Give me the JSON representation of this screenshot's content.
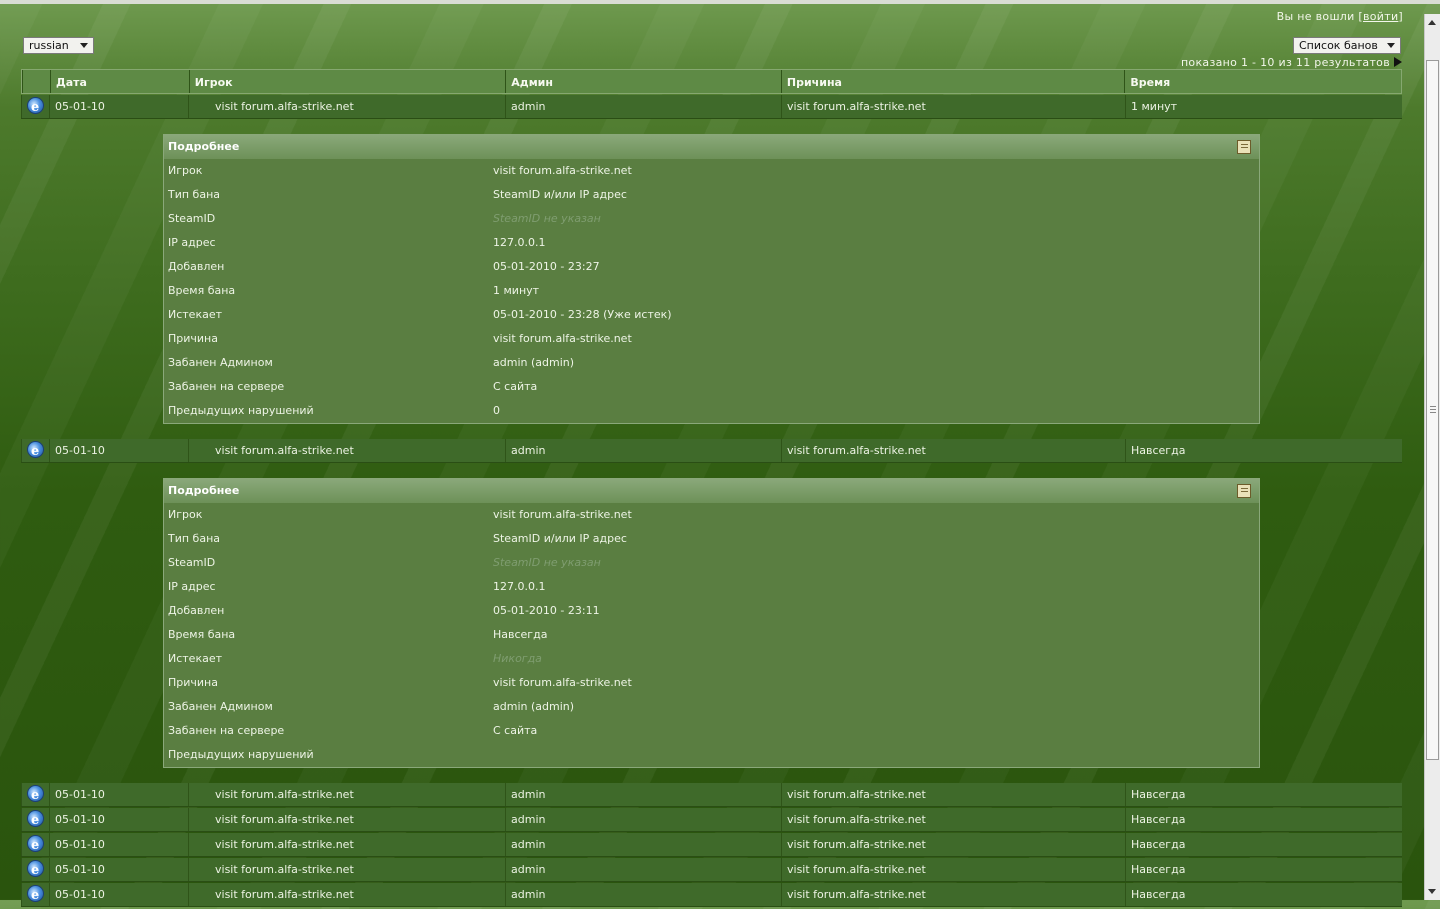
{
  "header": {
    "login_prefix": "Вы не вошли [",
    "login_link": "войти",
    "login_suffix": "]"
  },
  "language_select": {
    "value": "russian"
  },
  "view_select": {
    "value": "Список банов"
  },
  "pager": {
    "text": "показано 1 - 10 из 11 результатов"
  },
  "table": {
    "columns": [
      "Дата",
      "Игрок",
      "Админ",
      "Причина",
      "Время"
    ],
    "rows": [
      {
        "date": "05-01-10",
        "player": "visit forum.alfa-strike.net",
        "admin": "admin",
        "reason": "visit forum.alfa-strike.net",
        "time": "1 минут"
      },
      {
        "date": "05-01-10",
        "player": "visit forum.alfa-strike.net",
        "admin": "admin",
        "reason": "visit forum.alfa-strike.net",
        "time": "Навсегда"
      },
      {
        "date": "05-01-10",
        "player": "visit forum.alfa-strike.net",
        "admin": "admin",
        "reason": "visit forum.alfa-strike.net",
        "time": "Навсегда"
      },
      {
        "date": "05-01-10",
        "player": "visit forum.alfa-strike.net",
        "admin": "admin",
        "reason": "visit forum.alfa-strike.net",
        "time": "Навсегда"
      },
      {
        "date": "05-01-10",
        "player": "visit forum.alfa-strike.net",
        "admin": "admin",
        "reason": "visit forum.alfa-strike.net",
        "time": "Навсегда"
      },
      {
        "date": "05-01-10",
        "player": "visit forum.alfa-strike.net",
        "admin": "admin",
        "reason": "visit forum.alfa-strike.net",
        "time": "Навсегда"
      },
      {
        "date": "05-01-10",
        "player": "visit forum.alfa-strike.net",
        "admin": "admin",
        "reason": "visit forum.alfa-strike.net",
        "time": "Навсегда"
      }
    ]
  },
  "details": [
    {
      "title": "Подробнее",
      "fields": [
        {
          "label": "Игрок",
          "value": "visit forum.alfa-strike.net"
        },
        {
          "label": "Тип бана",
          "value": "SteamID и/или IP адрес"
        },
        {
          "label": "SteamID",
          "value": "SteamID не указан"
        },
        {
          "label": "IP адрес",
          "value": "127.0.0.1"
        },
        {
          "label": "Добавлен",
          "value": "05-01-2010 - 23:27"
        },
        {
          "label": "Время бана",
          "value": "1  минут"
        },
        {
          "label": "Истекает",
          "value": "05-01-2010 - 23:28  (Уже истек)"
        },
        {
          "label": "Причина",
          "value": "visit forum.alfa-strike.net"
        },
        {
          "label": "Забанен Админом",
          "value": "admin (admin)"
        },
        {
          "label": "Забанен на сервере",
          "value": "С сайта"
        },
        {
          "label": "Предыдущих нарушений",
          "value": "0"
        }
      ]
    },
    {
      "title": "Подробнее",
      "fields": [
        {
          "label": "Игрок",
          "value": "visit forum.alfa-strike.net"
        },
        {
          "label": "Тип бана",
          "value": "SteamID и/или IP адрес"
        },
        {
          "label": "SteamID",
          "value": "SteamID не указан"
        },
        {
          "label": "IP адрес",
          "value": "127.0.0.1"
        },
        {
          "label": "Добавлен",
          "value": "05-01-2010 - 23:11"
        },
        {
          "label": "Время бана",
          "value": "Навсегда"
        },
        {
          "label": "Истекает",
          "value": "Никогда"
        },
        {
          "label": "Причина",
          "value": "visit forum.alfa-strike.net"
        },
        {
          "label": "Забанен Админом",
          "value": "admin (admin)"
        },
        {
          "label": "Забанен на сервере",
          "value": "С сайта"
        },
        {
          "label": "Предыдущих нарушений",
          "value": ""
        }
      ]
    }
  ],
  "icons": {
    "row_icon": "ie-browser-icon",
    "details_icon": "copy-details-icon"
  },
  "colors": {
    "accent": "#3f6a2a",
    "header": "#5e8a45",
    "muted": "#7f9d70"
  }
}
